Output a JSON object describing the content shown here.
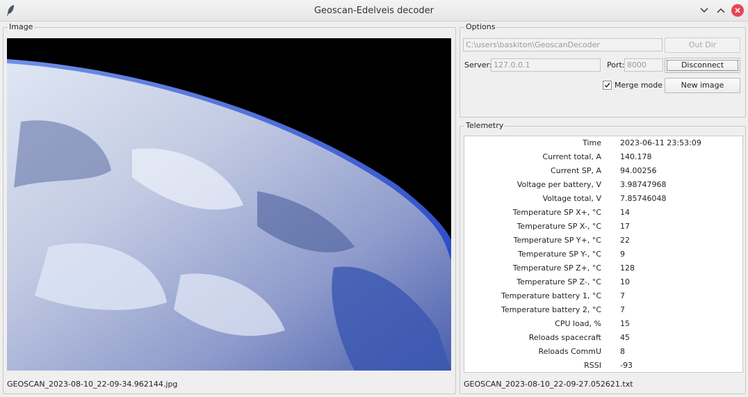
{
  "window": {
    "title": "Geoscan-Edelveis decoder"
  },
  "image_panel": {
    "group_label": "Image",
    "filename": "GEOSCAN_2023-08-10_22-09-34.962144.jpg"
  },
  "options": {
    "group_label": "Options",
    "out_dir_value": "C:\\users\\baskiton\\GeoscanDecoder",
    "out_dir_button": "Out Dir",
    "server_label": "Server:",
    "server_value": "127.0.0.1",
    "port_label": "Port:",
    "port_value": "8000",
    "connect_button": "Disconnect",
    "merge_mode_label": "Merge mode",
    "merge_mode_checked": true,
    "new_image_button": "New image"
  },
  "telemetry": {
    "group_label": "Telemetry",
    "rows": [
      {
        "key": "Time",
        "value": "2023-06-11 23:53:09"
      },
      {
        "key": "Current total, A",
        "value": "140.178"
      },
      {
        "key": "Current SP, A",
        "value": "94.00256"
      },
      {
        "key": "Voltage per battery, V",
        "value": "3.98747968"
      },
      {
        "key": "Voltage total, V",
        "value": "7.85746048"
      },
      {
        "key": "Temperature SP X+, °C",
        "value": "14"
      },
      {
        "key": "Temperature SP X-, °C",
        "value": "17"
      },
      {
        "key": "Temperature SP Y+, °C",
        "value": "22"
      },
      {
        "key": "Temperature SP Y-, °C",
        "value": "9"
      },
      {
        "key": "Temperature SP Z+, °C",
        "value": "128"
      },
      {
        "key": "Temperature SP Z-, °C",
        "value": "10"
      },
      {
        "key": "Temperature battery 1, °C",
        "value": "7"
      },
      {
        "key": "Temperature battery 2, °C",
        "value": "7"
      },
      {
        "key": "CPU load, %",
        "value": "15"
      },
      {
        "key": "Reloads spacecraft",
        "value": "45"
      },
      {
        "key": "Reloads CommU",
        "value": "8"
      },
      {
        "key": "RSSI",
        "value": "-93"
      }
    ],
    "filename": "GEOSCAN_2023-08-10_22-09-27.052621.txt"
  },
  "colors": {
    "close_button": "#e64553",
    "space": "#000000"
  }
}
